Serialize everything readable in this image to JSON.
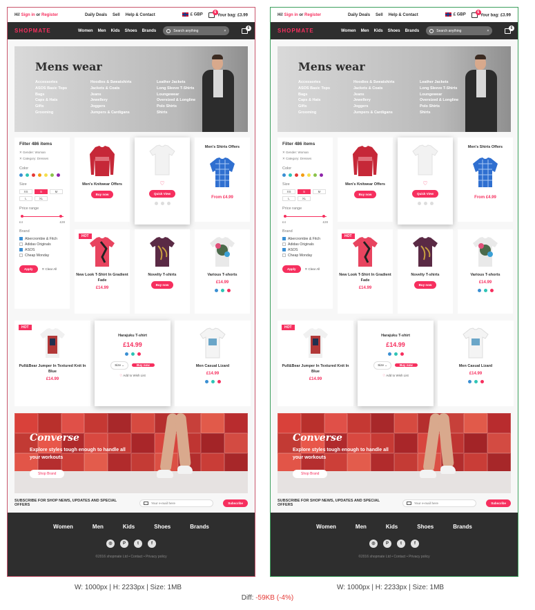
{
  "topbar": {
    "hi": "Hi!",
    "signin": "Sign in",
    "or": "or",
    "register": "Register",
    "links": [
      "Daily Deals",
      "Sell",
      "Help & Contact"
    ],
    "currency": "£ GBP",
    "bag_count": "6",
    "bag_label": "Your bag: £3.99"
  },
  "nav": {
    "logo": "SHOPMATE",
    "links": [
      "Women",
      "Men",
      "Kids",
      "Shoes",
      "Brands"
    ],
    "search_placeholder": "Search anything",
    "bag_count": "6"
  },
  "hero": {
    "title": "Mens wear",
    "columns": [
      [
        "Accessories",
        "ASOS Basic Tops",
        "Bags",
        "Caps & Hats",
        "Gifts",
        "Grooming"
      ],
      [
        "Hoodies & Sweatshirts",
        "Jackets & Coats",
        "Jeans",
        "Jewellery",
        "Joggers",
        "Jumpers & Cardigans"
      ],
      [
        "Leather Jackets",
        "Long Sleeve T-Shirts",
        "Loungewear",
        "Oversized & Longline",
        "Polo Shirts",
        "Shirts"
      ]
    ]
  },
  "filter": {
    "title": "Filter 486 items",
    "tags": [
      "Gender: Woman",
      "Category: Dresses"
    ],
    "color_label": "Color",
    "colors": [
      "#3a8fd3",
      "#2ec4b6",
      "#e53935",
      "#f39c12",
      "#f4e04d",
      "#8bc34a",
      "#8e24aa"
    ],
    "size_label": "Size",
    "sizes": [
      "XS",
      "S",
      "M",
      "L",
      "XL"
    ],
    "selected_size": "S",
    "price_label": "Price range",
    "price_min": "£4",
    "price_max": "£28",
    "brand_label": "Brand",
    "brands": [
      "Abercrombie & Fitch",
      "Adidas Originals",
      "ASOS",
      "Cheap Monday"
    ],
    "apply": "Apply",
    "clear": "✕ Clear All"
  },
  "cards": [
    {
      "title": "Men's Knitwear Offers",
      "button": "Buy now"
    },
    {
      "button": "Quick View"
    },
    {
      "title": "Men's Shirts Offers",
      "price": "From £4.99"
    },
    {
      "hot": "HOT",
      "title": "New Look T-Shirt In Gradient Fade",
      "price": "£14.99"
    },
    {
      "title": "Novelty T-shirts",
      "button": "Buy now"
    },
    {
      "title": "Various T-shorts",
      "price": "£14.99"
    }
  ],
  "bigrow": [
    {
      "hot": "HOT",
      "title": "Pull&Bear Jumper In Textured Knit In Blue",
      "price": "£14.99"
    },
    {
      "title": "Harajuku T-shirt",
      "price": "£14.99",
      "size": "Size",
      "button": "Buy now",
      "wish": "Add to Wish List"
    },
    {
      "title": "Men Casual Lizard",
      "price": "£14.99"
    }
  ],
  "banner": {
    "title": "Converse",
    "text": "Explore styles tough enough to handle all your workouts",
    "button": "Shop Brand"
  },
  "subscribe": {
    "label": "SUBSCRIBE FOR SHOP NEWS, UPDATES AND SPECIAL OFFERS",
    "placeholder": "Your e-mail here",
    "button": "Subscribe"
  },
  "footer": {
    "links": [
      "Women",
      "Men",
      "Kids",
      "Shoes",
      "Brands"
    ],
    "copyright": "©2016 shopmate Ltd • Contact • Privacy policy"
  },
  "captions": {
    "left": "W: 1000px | H: 2233px | Size: 1MB",
    "right": "W: 1000px | H: 2233px | Size: 1MB",
    "diff_label": "Diff:",
    "diff_value": "-59KB (-4%)"
  }
}
